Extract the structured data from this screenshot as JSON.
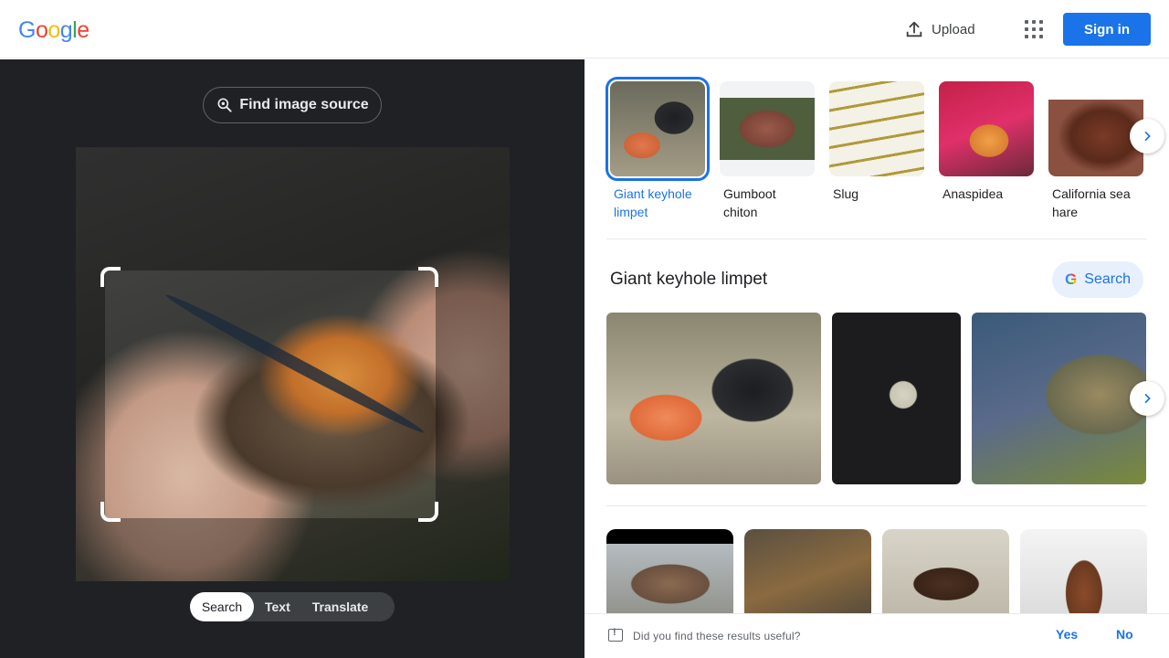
{
  "header": {
    "logo": {
      "G": "G",
      "o1": "o",
      "o2": "o",
      "g": "g",
      "l": "l",
      "e": "e"
    },
    "upload_label": "Upload",
    "signin_label": "Sign in",
    "accent": "#1a73e8"
  },
  "lens": {
    "find_source_label": "Find image source",
    "modes": [
      {
        "label": "Search",
        "active": true
      },
      {
        "label": "Text",
        "active": false
      },
      {
        "label": "Translate",
        "active": false
      }
    ]
  },
  "results": {
    "chips": [
      {
        "label": "Giant keyhole limpet",
        "selected": true
      },
      {
        "label": "Gumboot chiton",
        "selected": false
      },
      {
        "label": "Slug",
        "selected": false
      },
      {
        "label": "Anaspidea",
        "selected": false
      },
      {
        "label": "California sea hare",
        "selected": false
      }
    ],
    "section_title": "Giant keyhole limpet",
    "search_button_label": "Search",
    "feedback": {
      "question": "Did you find these results useful?",
      "yes": "Yes",
      "no": "No"
    }
  }
}
